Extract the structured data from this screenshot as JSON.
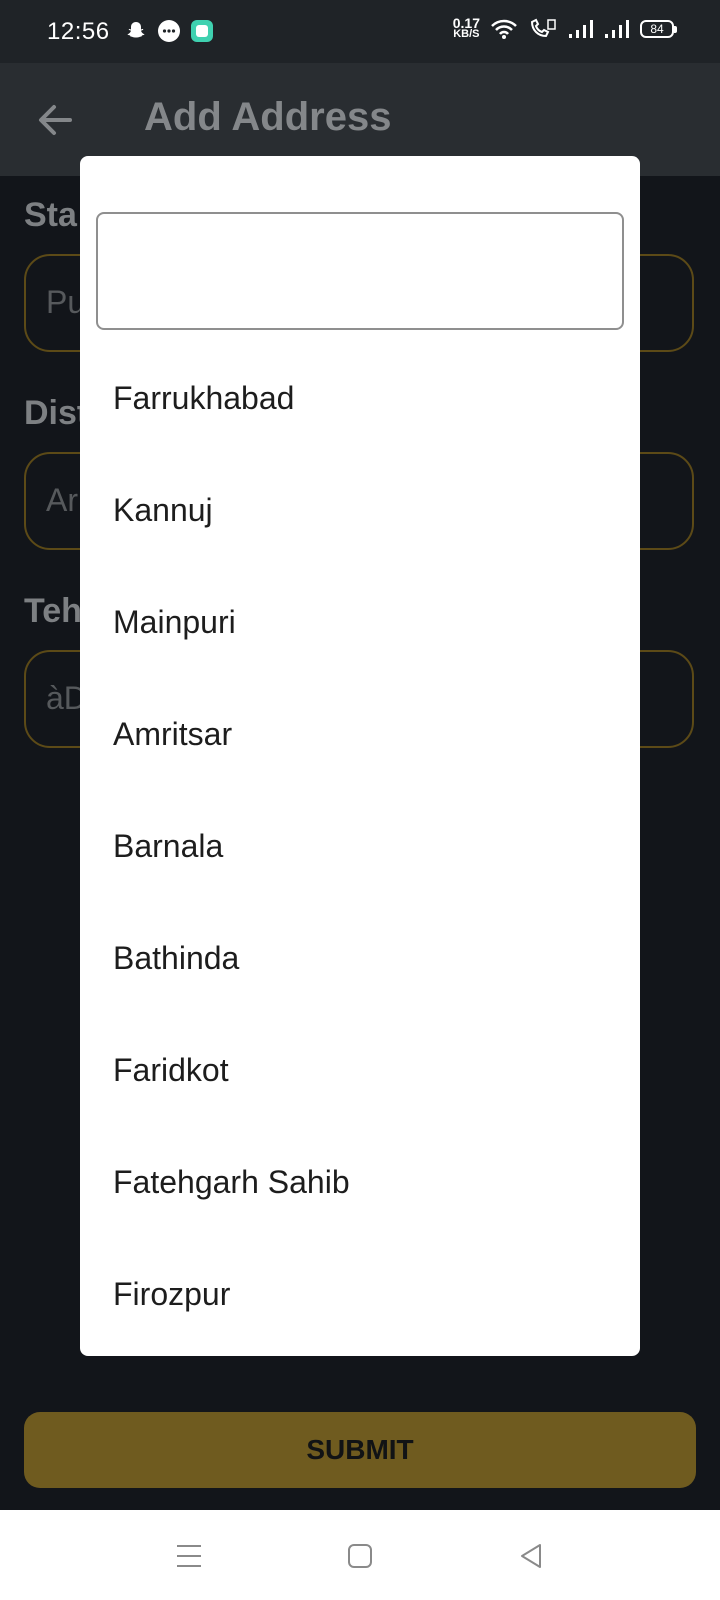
{
  "status_bar": {
    "time": "12:56",
    "net_speed_value": "0.17",
    "net_speed_unit": "KB/S",
    "battery": "84",
    "icons": [
      "snapchat-icon",
      "message-icon",
      "app-icon",
      "wifi-icon",
      "wifi-calling-icon",
      "signal-icon",
      "signal-icon"
    ]
  },
  "app_bar": {
    "back_icon": "arrow-left-icon",
    "title": "Add Address"
  },
  "form": {
    "fields": [
      {
        "label": "Sta",
        "value": "Pu"
      },
      {
        "label": "Dist",
        "value": "Ar"
      },
      {
        "label": "Teh",
        "value": "àD"
      }
    ],
    "submit_label": "SUBMIT"
  },
  "dialog": {
    "search_value": "",
    "options": [
      "Farrukhabad",
      "Kannuj",
      "Mainpuri",
      "Amritsar",
      "Barnala",
      "Bathinda",
      "Faridkot",
      "Fatehgarh Sahib",
      "Firozpur"
    ]
  },
  "nav_bar": {
    "icons": [
      "menu-icon",
      "home-icon",
      "back-icon"
    ]
  },
  "colors": {
    "accent": "#6f5b1f",
    "field_border": "#5c4a17",
    "background": "#12151a",
    "app_bar": "#292d31"
  }
}
